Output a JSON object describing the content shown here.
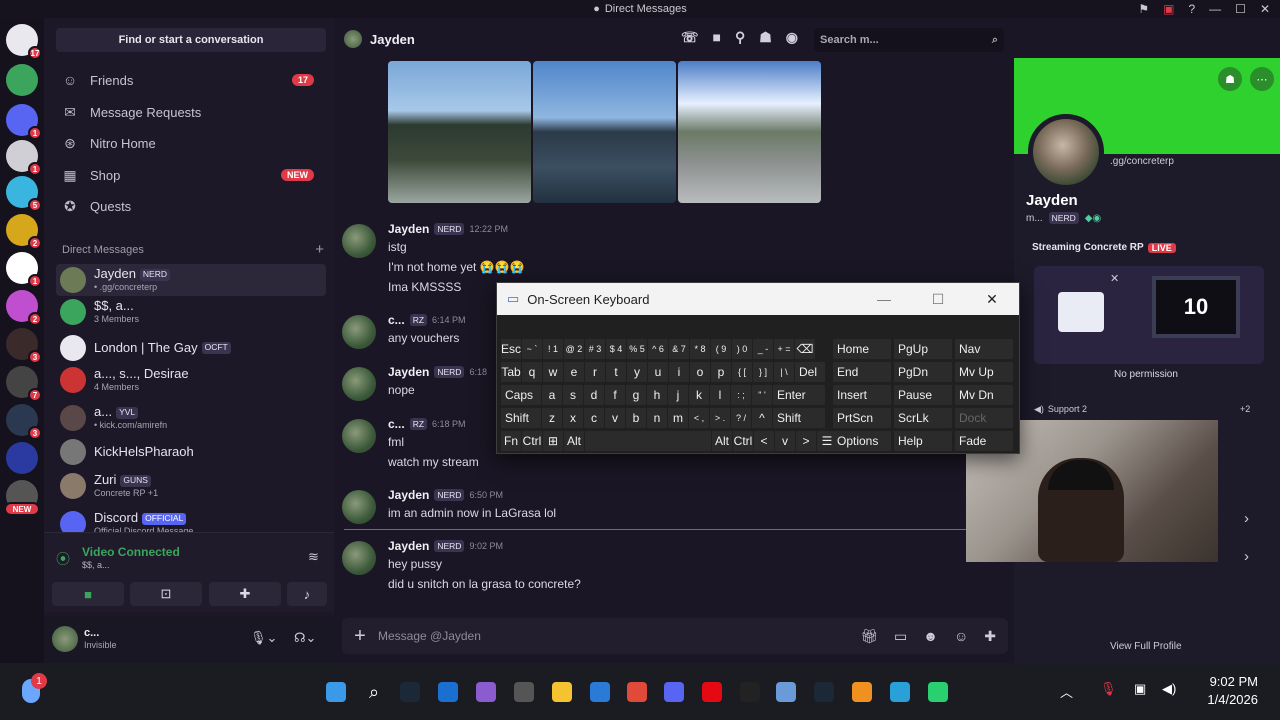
{
  "window": {
    "title": "Direct Messages"
  },
  "servers": [
    {
      "badge": "17",
      "color": "#e8e8ee"
    },
    {
      "badge": "",
      "color": "#3ba55d"
    },
    {
      "badge": "1",
      "color": "#5865f2"
    },
    {
      "badge": "1",
      "color": "#d0cfd6"
    },
    {
      "badge": "5",
      "color": "#39b5e0"
    },
    {
      "badge": "2",
      "color": "#d6a71a"
    },
    {
      "badge": "1",
      "color": "#ffffff"
    },
    {
      "badge": "2",
      "color": "#c04fd0"
    },
    {
      "badge": "3",
      "color": "#3a2a2a"
    },
    {
      "badge": "7",
      "color": "#444"
    },
    {
      "badge": "3",
      "color": "#2a3850"
    },
    {
      "badge": "",
      "color": "#2a3aa0"
    },
    {
      "badge": "NEW",
      "color": "#555"
    }
  ],
  "sidebar": {
    "find": "Find or start a conversation",
    "nav": [
      {
        "label": "Friends",
        "icon": "friends-icon",
        "pill": "17"
      },
      {
        "label": "Message Requests",
        "icon": "mail-icon",
        "pill": ""
      },
      {
        "label": "Nitro Home",
        "icon": "nitro-icon",
        "pill": ""
      },
      {
        "label": "Shop",
        "icon": "shop-icon",
        "pill": "NEW"
      },
      {
        "label": "Quests",
        "icon": "quests-icon",
        "pill": ""
      }
    ],
    "dm_header": "Direct Messages",
    "dms": [
      {
        "name": "Jayden",
        "tag": "NERD",
        "sub": "• .gg/concreterp",
        "color": "#6c7a55"
      },
      {
        "name": "$$, a...",
        "tag": "",
        "sub": "3 Members",
        "color": "#3ba55d"
      },
      {
        "name": "London | The Gay",
        "tag": "OCFT",
        "sub": "",
        "color": "#e8e8ee"
      },
      {
        "name": "a..., s..., Desirae",
        "tag": "",
        "sub": "4 Members",
        "color": "#c33"
      },
      {
        "name": "a...",
        "tag": "YVL",
        "sub": "• kick.com/amirefn",
        "color": "#5a4848"
      },
      {
        "name": "KickHelsPharaoh",
        "tag": "",
        "sub": "",
        "color": "#777"
      },
      {
        "name": "Zuri",
        "tag": "GUNS",
        "sub": "Concrete RP +1",
        "color": "#8a7a6a"
      },
      {
        "name": "Discord",
        "tag": "OFFICIAL",
        "sub": "Official Discord Message",
        "color": "#5865f2"
      }
    ],
    "voice": {
      "status": "Video Connected",
      "sub": "$$, a..."
    },
    "user": {
      "name": "c...",
      "status": "Invisible"
    }
  },
  "chat": {
    "recipient": "Jayden",
    "search_placeholder": "Search m...",
    "input_placeholder": "Message @Jayden",
    "messages": [
      {
        "name": "Jayden",
        "tag": "NERD",
        "time": "12:22 PM",
        "lines": [
          "istg",
          "I'm not home yet 😭😭😭",
          "Ima KMSSSS"
        ]
      },
      {
        "name": "c...",
        "tag": "RZ",
        "time": "6:14 PM",
        "lines": [
          "any vouchers"
        ]
      },
      {
        "name": "Jayden",
        "tag": "NERD",
        "time": "6:18",
        "lines": [
          "nope"
        ]
      },
      {
        "name": "c...",
        "tag": "RZ",
        "time": "6:18 PM",
        "lines": [
          "fml",
          "watch my stream"
        ]
      },
      {
        "name": "Jayden",
        "tag": "NERD",
        "time": "6:50 PM",
        "lines": [
          "im an admin now in LaGrasa lol"
        ]
      },
      {
        "name": "Jayden",
        "tag": "NERD",
        "time": "9:02 PM",
        "lines": [
          "hey pussy",
          "did u snitch on la grasa to concrete?"
        ]
      }
    ]
  },
  "profile": {
    "server_link": ".gg/concreterp",
    "name": "Jayden",
    "short": "m...",
    "tag": "NERD",
    "streaming": "Streaming Concrete RP",
    "live": "LIVE",
    "no_permission": "No permission",
    "channel": "Support 2",
    "extra": "+2",
    "tv_number": "10",
    "view_full": "View Full Profile"
  },
  "osk": {
    "title": "On-Screen Keyboard",
    "rows": [
      [
        "Esc",
        "~ `",
        "! 1",
        "@ 2",
        "# 3",
        "$ 4",
        "% 5",
        "^ 6",
        "& 7",
        "* 8",
        "( 9",
        ") 0",
        "_ -",
        "+ =",
        "⌫"
      ],
      [
        "Tab",
        "q",
        "w",
        "e",
        "r",
        "t",
        "y",
        "u",
        "i",
        "o",
        "p",
        "{ [",
        "} ]",
        "| \\",
        "Del"
      ],
      [
        "Caps",
        "a",
        "s",
        "d",
        "f",
        "g",
        "h",
        "j",
        "k",
        "l",
        ": ;",
        "\" '",
        "Enter"
      ],
      [
        "Shift",
        "z",
        "x",
        "c",
        "v",
        "b",
        "n",
        "m",
        "< ,",
        "> .",
        "? /",
        "^",
        "Shift"
      ],
      [
        "Fn",
        "Ctrl",
        "⊞",
        "Alt",
        "",
        "Alt",
        "Ctrl",
        "<",
        "v",
        ">",
        "☰"
      ]
    ],
    "side": [
      [
        "Home",
        "PgUp",
        "Nav"
      ],
      [
        "End",
        "PgDn",
        "Mv Up"
      ],
      [
        "Insert",
        "Pause",
        "Mv Dn"
      ],
      [
        "PrtScn",
        "ScrLk",
        "Dock"
      ],
      [
        "Options",
        "Help",
        "Fade"
      ]
    ]
  },
  "taskbar": {
    "time": "9:02 PM",
    "date": "1/4/2026",
    "weather_badge": "1"
  }
}
